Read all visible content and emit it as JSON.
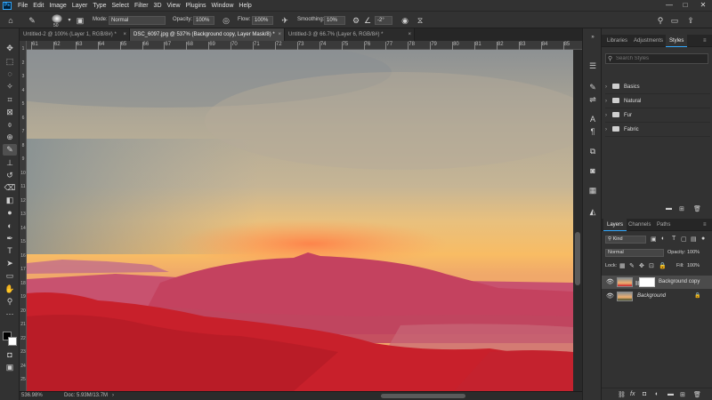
{
  "menu": {
    "logo": "Ps",
    "items": [
      "File",
      "Edit",
      "Image",
      "Layer",
      "Type",
      "Select",
      "Filter",
      "3D",
      "View",
      "Plugins",
      "Window",
      "Help"
    ],
    "window_buttons": [
      "—",
      "□",
      "✕"
    ]
  },
  "options": {
    "brush_size": "50",
    "mode_label": "Mode:",
    "mode_value": "Normal",
    "opacity_label": "Opacity:",
    "opacity_value": "100%",
    "flow_label": "Flow:",
    "flow_value": "100%",
    "smoothing_label": "Smoothing:",
    "smoothing_value": "10%",
    "angle_value": "-2°"
  },
  "tabs": [
    {
      "label": "Untitled-2 @ 100% (Layer 1, RGB/8#) *",
      "close": "×"
    },
    {
      "label": "DSC_6097.jpg @ 537% (Background copy, Layer Mask/8) *",
      "close": "×"
    },
    {
      "label": "Untitled-3 @ 66.7% (Layer 6, RGB/8#) *",
      "close": "×"
    }
  ],
  "ruler": {
    "h_ticks": [
      "61",
      "62",
      "63",
      "64",
      "65",
      "66",
      "67",
      "68",
      "69",
      "70",
      "71",
      "72",
      "73",
      "74",
      "75",
      "76",
      "77",
      "78",
      "79",
      "80",
      "81",
      "82",
      "83",
      "84",
      "85"
    ],
    "v_ticks": [
      "1",
      "2",
      "3",
      "4",
      "5",
      "6",
      "7",
      "8",
      "9",
      "10",
      "11",
      "12",
      "13",
      "14",
      "15",
      "16",
      "17",
      "18",
      "19",
      "20",
      "21",
      "22",
      "23",
      "24",
      "25"
    ]
  },
  "status": {
    "zoom": "536.98%",
    "doc": "Doc: 5.93M/13.7M",
    "arrow": "›"
  },
  "panels": {
    "top_tabs": [
      "Libraries",
      "Adjustments",
      "Styles"
    ],
    "search_placeholder": "Search Styles",
    "style_groups": [
      "Basics",
      "Natural",
      "Fur",
      "Fabric"
    ],
    "layer_tabs": [
      "Layers",
      "Channels",
      "Paths"
    ],
    "kind_label": "Kind",
    "blend_mode": "Normal",
    "opacity_label": "Opacity:",
    "opacity_value": "100%",
    "lock_label": "Lock:",
    "fill_label": "Fill:",
    "fill_value": "100%",
    "layers": [
      {
        "name": "Background copy",
        "selected": true
      },
      {
        "name": "Background",
        "selected": false
      }
    ]
  },
  "colors": {
    "accent": "#31a8ff",
    "mask_red": "#c8222d",
    "sky_top": "#8a8f90",
    "sky_glow": "#f6b45a"
  }
}
